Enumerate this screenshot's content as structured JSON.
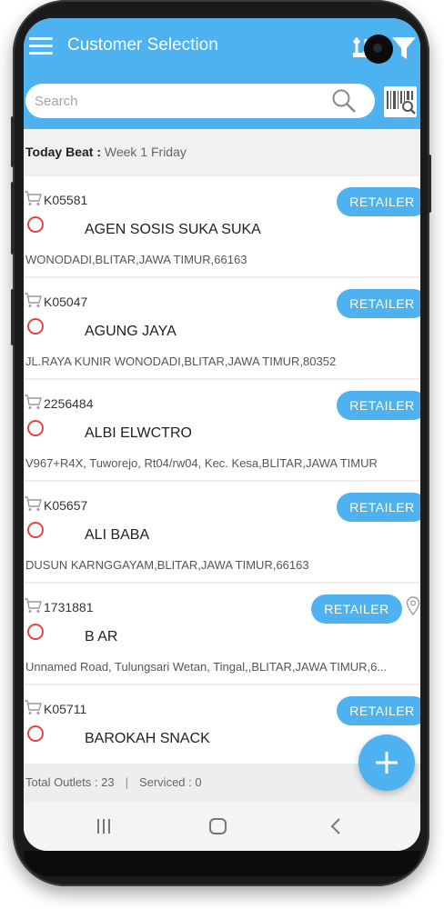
{
  "header": {
    "title": "Customer Selection",
    "icons": [
      "menu-icon",
      "sort-icon",
      "filter-icon"
    ]
  },
  "search": {
    "placeholder": "Search",
    "value": ""
  },
  "beat": {
    "label": "Today Beat : ",
    "value": "Week 1 Friday"
  },
  "customers": [
    {
      "code": "K05581",
      "name": "AGEN SOSIS SUKA SUKA",
      "address": "WONODADI,BLITAR,JAWA TIMUR,66163",
      "type": "RETAILER",
      "has_location": false
    },
    {
      "code": "K05047",
      "name": "AGUNG JAYA",
      "address": "JL.RAYA KUNIR WONODADI,BLITAR,JAWA TIMUR,80352",
      "type": "RETAILER",
      "has_location": false
    },
    {
      "code": "2256484",
      "name": "ALBI ELWCTRO",
      "address": "V967+R4X, Tuworejo, Rt04/rw04, Kec. Kesa,BLITAR,JAWA TIMUR",
      "type": "RETAILER",
      "has_location": false
    },
    {
      "code": "K05657",
      "name": "ALI BABA",
      "address": "DUSUN KARNGGAYAM,BLITAR,JAWA TIMUR,66163",
      "type": "RETAILER",
      "has_location": false
    },
    {
      "code": "1731881",
      "name": "B AR",
      "address": "Unnamed Road, Tulungsari Wetan, Tingal,,BLITAR,JAWA TIMUR,6...",
      "type": "RETAILER",
      "has_location": true
    },
    {
      "code": "K05711",
      "name": "BAROKAH SNACK",
      "address": "",
      "type": "RETAILER",
      "has_location": false
    }
  ],
  "footer": {
    "total_outlets": "Total Outlets : 23",
    "separator": "|",
    "serviced": "Serviced : 0"
  },
  "colors": {
    "primary": "#4db2ef",
    "status_ring": "#e0493b",
    "background": "#eeeeee"
  },
  "nav": [
    "recent-apps-icon",
    "home-icon",
    "back-icon"
  ]
}
